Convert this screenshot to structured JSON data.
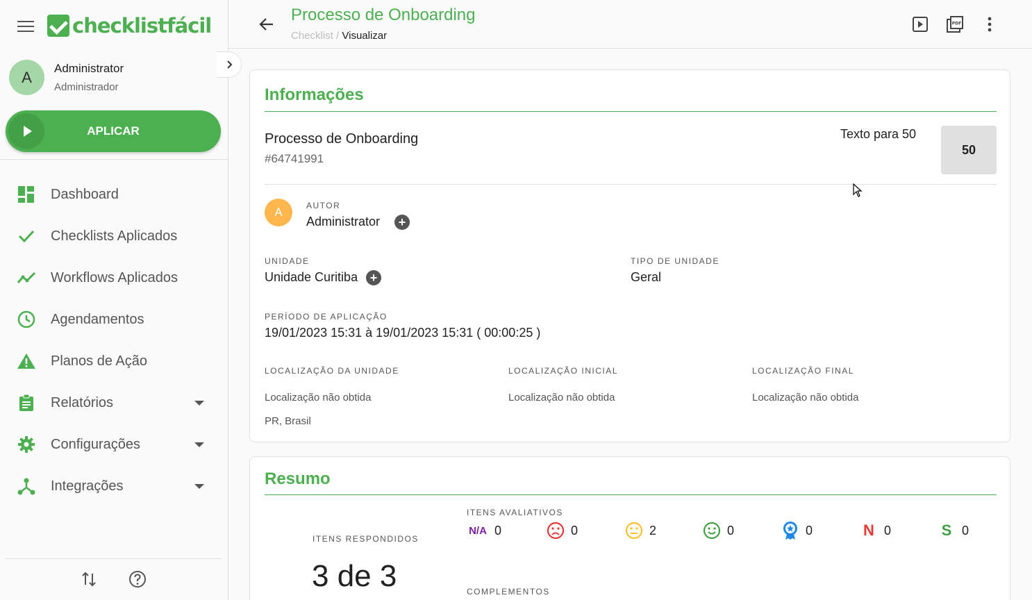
{
  "app": {
    "logo_text": "checklistfácil",
    "brand_color": "#4caf50"
  },
  "sidebar": {
    "user": {
      "avatar_letter": "A",
      "name": "Administrator",
      "role": "Administrador"
    },
    "apply_label": "APLICAR",
    "items": [
      {
        "label": "Dashboard",
        "icon": "dashboard-icon"
      },
      {
        "label": "Checklists Aplicados",
        "icon": "check-icon"
      },
      {
        "label": "Workflows Aplicados",
        "icon": "trending-icon"
      },
      {
        "label": "Agendamentos",
        "icon": "clock-icon"
      },
      {
        "label": "Planos de Ação",
        "icon": "warning-icon"
      },
      {
        "label": "Relatórios",
        "icon": "clipboard-icon",
        "expandable": true
      },
      {
        "label": "Configurações",
        "icon": "gear-icon",
        "expandable": true
      },
      {
        "label": "Integrações",
        "icon": "integration-icon",
        "expandable": true
      }
    ]
  },
  "header": {
    "title": "Processo de Onboarding",
    "breadcrumb": [
      "Checklist",
      "Visualizar"
    ],
    "breadcrumb_sep": "/"
  },
  "info": {
    "section_title": "Informações",
    "checklist_name": "Processo de Onboarding",
    "checklist_id": "#64741991",
    "score_text": "Texto para 50",
    "score_value": "50",
    "author_label": "AUTOR",
    "author_avatar": "A",
    "author_name": "Administrator",
    "unit_label": "UNIDADE",
    "unit_value": "Unidade Curitiba",
    "unit_type_label": "TIPO DE UNIDADE",
    "unit_type_value": "Geral",
    "period_label": "PERÍODO DE APLICAÇÃO",
    "period_value": "19/01/2023 15:31 à 19/01/2023 15:31 ( 00:00:25 )",
    "loc_unit_label": "LOCALIZAÇÃO DA UNIDADE",
    "loc_unit_value": "Localização não obtida",
    "loc_unit_extra": "PR, Brasil",
    "loc_initial_label": "LOCALIZAÇÃO INICIAL",
    "loc_initial_value": "Localização não obtida",
    "loc_final_label": "LOCALIZAÇÃO FINAL",
    "loc_final_value": "Localização não obtida"
  },
  "summary": {
    "section_title": "Resumo",
    "answered_label": "ITENS RESPONDIDOS",
    "answered_value": "3 de 3",
    "evaluative_label": "ITENS AVALIATIVOS",
    "complements_label": "COMPLEMENTOS",
    "ratings": [
      {
        "icon": "na-icon",
        "symbol": "N/A",
        "count": "0",
        "color": "#7b1fa2"
      },
      {
        "icon": "sad-face-icon",
        "count": "0",
        "color": "#e53935"
      },
      {
        "icon": "neutral-face-icon",
        "count": "2",
        "color": "#fbc02d"
      },
      {
        "icon": "happy-face-icon",
        "count": "0",
        "color": "#43a047"
      },
      {
        "icon": "medal-icon",
        "count": "0",
        "color": "#1e88e5"
      },
      {
        "icon": "no-icon",
        "symbol": "N",
        "count": "0",
        "color": "#e53935"
      },
      {
        "icon": "yes-icon",
        "symbol": "S",
        "count": "0",
        "color": "#43a047"
      }
    ]
  }
}
